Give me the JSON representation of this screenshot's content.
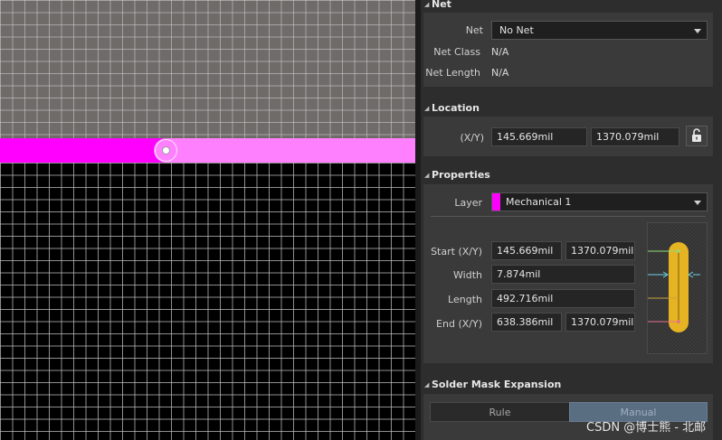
{
  "net_section": {
    "title": "Net",
    "net_label": "Net",
    "net_value": "No Net",
    "net_class_label": "Net Class",
    "net_class_value": "N/A",
    "net_length_label": "Net Length",
    "net_length_value": "N/A"
  },
  "location_section": {
    "title": "Location",
    "xy_label": "(X/Y)",
    "x": "145.669mil",
    "y": "1370.079mil",
    "lock_icon": "unlock-icon"
  },
  "properties_section": {
    "title": "Properties",
    "layer_label": "Layer",
    "layer_value": "Mechanical 1",
    "layer_color": "#ff00ff",
    "start_label": "Start (X/Y)",
    "start_x": "145.669mil",
    "start_y": "1370.079mil",
    "width_label": "Width",
    "width_value": "7.874mil",
    "length_label": "Length",
    "length_value": "492.716mil",
    "end_label": "End (X/Y)",
    "end_x": "638.386mil",
    "end_y": "1370.079mil"
  },
  "solder_mask_section": {
    "title": "Solder Mask Expansion",
    "rule_label": "Rule",
    "manual_label": "Manual",
    "selected": "Manual"
  },
  "colors": {
    "track_selected": "#ff00ff",
    "track_highlight": "#ff80ff",
    "panel_bg": "#2d2d2d",
    "diagram_track": "#e6b422"
  },
  "watermark": "CSDN @博士熊 - 北邮"
}
